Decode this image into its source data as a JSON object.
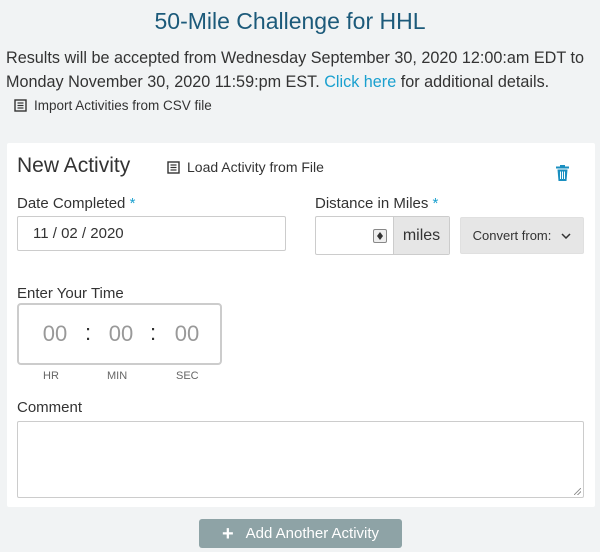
{
  "page": {
    "title": "50-Mile Challenge for HHL",
    "intro_text": "Results will be accepted from Wednesday September 30, 2020 12:00:am EDT to Monday November 30, 2020 11:59:pm EST.",
    "intro_link": "Click here",
    "intro_suffix": "for additional details.",
    "import_label": "Import Activities from CSV file"
  },
  "activity": {
    "heading": "New Activity",
    "load_label": "Load Activity from File",
    "date_label": "Date Completed",
    "date_value": "11 / 02 / 2020",
    "distance_label": "Distance in Miles",
    "distance_value": "",
    "distance_unit": "miles",
    "convert_label": "Convert from:",
    "time_label": "Enter Your Time",
    "time": {
      "hr": "00",
      "min": "00",
      "sec": "00"
    },
    "time_caps": {
      "hr": "HR",
      "min": "MIN",
      "sec": "SEC"
    },
    "separator": ":",
    "required_mark": "*",
    "comment_label": "Comment",
    "comment_value": ""
  },
  "add_button": {
    "plus": "+",
    "label": "Add Another Activity"
  },
  "colors": {
    "accent": "#1aa0cf",
    "title": "#1c5a7a",
    "add_button": "#8ea3a6"
  }
}
